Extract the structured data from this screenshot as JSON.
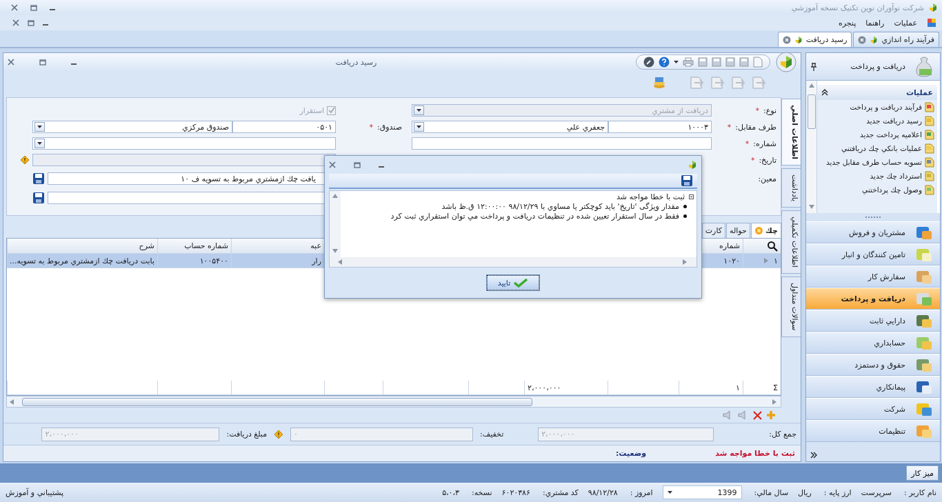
{
  "app_title": "شرکت نوآوران نوين تكنيک نسخه آموزشي",
  "menu": [
    {
      "label": "عمليات"
    },
    {
      "label": "راهنما"
    },
    {
      "label": "پنجره"
    }
  ],
  "tabs": [
    {
      "label": "فرآیند راه اندازي",
      "selected": false
    },
    {
      "label": "رسيد دريافت",
      "selected": true
    }
  ],
  "document": {
    "title": "رسيد دريافت",
    "side_tabs": [
      {
        "label": "اطلاعات اصلي",
        "selected": true
      },
      {
        "label": "يادداشت",
        "selected": false
      },
      {
        "label": "اطلاعات تكميلي",
        "selected": false
      },
      {
        "label": "سوالات متداول",
        "selected": false
      }
    ],
    "form": {
      "type": {
        "label": "نوع:",
        "mark": "*",
        "value": "دريافت از مشتري",
        "disabled": true
      },
      "counterparty": {
        "label": "طرف مقابل:",
        "mark": "*",
        "code": "۱۰۰۰۳",
        "name": "جعفري علي"
      },
      "number": {
        "label": "شماره:",
        "mark": "*"
      },
      "date": {
        "label": "تاريخ:",
        "mark": "*"
      },
      "ledger": {
        "label": "معين:"
      },
      "settled": {
        "label": "استقرار",
        "checked": true,
        "disabled": true
      },
      "cashbox": {
        "label": "صندوق:",
        "mark": "*",
        "code": "۰۵۰۱",
        "name": "صندوق مركزي"
      },
      "description": "يافت چك ازمشتري مربوط به تسويه ف ۱۰"
    },
    "payment_tabs": [
      {
        "label": "چك",
        "selected": true
      },
      {
        "label": "حواله",
        "selected": false
      },
      {
        "label": "كارت",
        "selected": false
      }
    ],
    "grid": {
      "columns": {
        "number": "شماره",
        "column_8": "عبه",
        "account": "شماره حساب",
        "description": "شرح"
      },
      "rows": [
        {
          "selected": true,
          "index": "۱",
          "number": "۱۰۲۰",
          "column_8": "رار",
          "account": "۱۰۰۵۴۰۰",
          "description": "بابت دريافت چك ازمشتري مربوط به تسويه..."
        }
      ],
      "summary": {
        "symbol": "Σ",
        "count": "۱",
        "amount": "۲،۰۰۰،۰۰۰"
      }
    },
    "totals": [
      {
        "label": "جمع كل:",
        "value": "۲،۰۰۰،۰۰۰",
        "disabled": true
      },
      {
        "label": "تخفيف:",
        "value": "۰",
        "disabled": true
      },
      {
        "label": "مبلغ دريافت:",
        "value": "۲،۰۰۰،۰۰۰",
        "disabled": true
      }
    ],
    "status": {
      "message": "ثبت با خطا مواجه شد",
      "label": "وضعيت:"
    }
  },
  "dialog": {
    "heading": "ثبت با خطا مواجه شد",
    "messages": [
      "مقدار ويژگی 'تاريخ' بايد كوچكتر يا مساوي با ۹۸/۱۲/۲۹ ۱۲:۰۰:۰۰ ق.ظ باشد",
      "فقط در سال استقرار تعيين شده در تنظيمات دريافت و پرداخت مي توان استقراري ثبت كرد"
    ],
    "ok_button": "تاييد"
  },
  "sidebar": {
    "title": "دريافت و پرداخت",
    "group_title": "عمليات",
    "tasks": [
      "فرآيند دريافت و پرداخت",
      "رسيد دريافت جديد",
      "اعلاميه پرداخت جديد",
      "عمليات بانكي چك دريافتني",
      "تسويه حساب طرف مقابل جديد",
      "استرداد چك جديد",
      "وصول چك پرداختني"
    ],
    "modules": [
      {
        "label": "مشتريان و فروش",
        "selected": false
      },
      {
        "label": "تامين كنندگان و انبار",
        "selected": false
      },
      {
        "label": "سفارش كار",
        "selected": false
      },
      {
        "label": "دريافت و پرداخت",
        "selected": true
      },
      {
        "label": "دارايي ثابت",
        "selected": false
      },
      {
        "label": "حسابداري",
        "selected": false
      },
      {
        "label": "حقوق و دستمزد",
        "selected": false
      },
      {
        "label": "پيمانكاري",
        "selected": false
      },
      {
        "label": "شركت",
        "selected": false
      },
      {
        "label": "تنظيمات",
        "selected": false
      }
    ]
  },
  "desktop_button": "ميز كار",
  "status_bar": {
    "items": [
      {
        "kind": "text",
        "label": "نام كاربر :",
        "value": "سرپرست"
      },
      {
        "kind": "text",
        "label": "ارز پايه :",
        "value": "ريال"
      },
      {
        "kind": "dropdown",
        "label": "سال مالي:",
        "value": "1399"
      },
      {
        "kind": "text",
        "label": "امروز :",
        "value": "۹۸/۱۲/۲۸"
      },
      {
        "kind": "text",
        "label": "كد مشتري:",
        "value": "۶۰۲۰۳۸۶"
      },
      {
        "kind": "text",
        "label": "نسخه:",
        "value": "۵،۰،۳"
      }
    ],
    "support": "پشتيباني و آموزش"
  }
}
